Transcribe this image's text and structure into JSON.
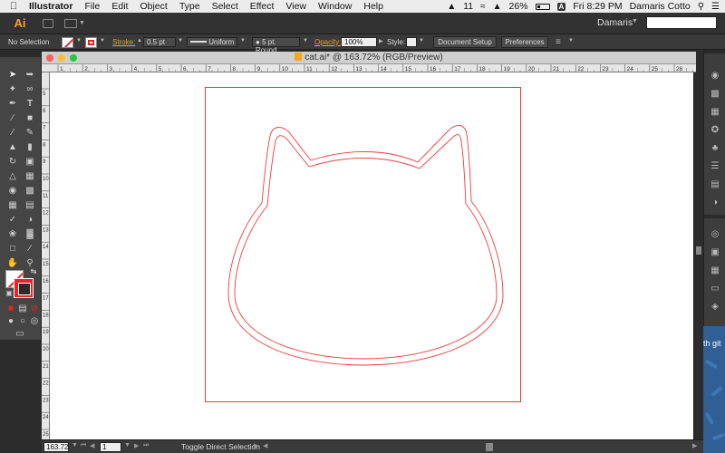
{
  "menubar": {
    "app_name": "Illustrator",
    "items": [
      "File",
      "Edit",
      "Object",
      "Type",
      "Select",
      "Effect",
      "View",
      "Window",
      "Help"
    ],
    "status": {
      "adobe_badge_count": "11",
      "battery": "26%",
      "datetime": "Fri 8:29 PM",
      "user": "Damaris Cotto"
    }
  },
  "appbar": {
    "logo": "Ai",
    "workspace_user": "Damaris",
    "search_placeholder": ""
  },
  "controlbar": {
    "selection_label": "No Selection",
    "stroke_label": "Stroke:",
    "stroke_weight": "0.5 pt",
    "profile": "Uniform",
    "brush": "5 pt. Round",
    "opacity_label": "Opacity:",
    "opacity_value": "100%",
    "style_label": "Style:",
    "document_setup": "Document Setup",
    "preferences": "Preferences"
  },
  "document": {
    "title": "cat.ai* @ 163.72% (RGB/Preview)",
    "stroke_color": "#ee3b3b"
  },
  "rulers": {
    "h_ticks": [
      "1",
      "2",
      "3",
      "4",
      "5",
      "6",
      "7",
      "8",
      "9",
      "10",
      "11",
      "12",
      "13",
      "14",
      "15",
      "16",
      "17",
      "18",
      "19",
      "20",
      "21",
      "22",
      "23",
      "24",
      "25",
      "26"
    ],
    "v_ticks": [
      "5",
      "6",
      "7",
      "8",
      "9",
      "10",
      "11",
      "12",
      "13",
      "14",
      "15",
      "16",
      "17",
      "18",
      "19",
      "20",
      "21",
      "22",
      "23",
      "24",
      "25"
    ]
  },
  "statusbar": {
    "zoom": "163.72",
    "artboard": "1",
    "message": "Toggle Direct Selection"
  },
  "desktop": {
    "fragment_text": "th git"
  },
  "colors": {
    "accent": "#f7a21b",
    "artboard_border": "#ee3b3b"
  }
}
